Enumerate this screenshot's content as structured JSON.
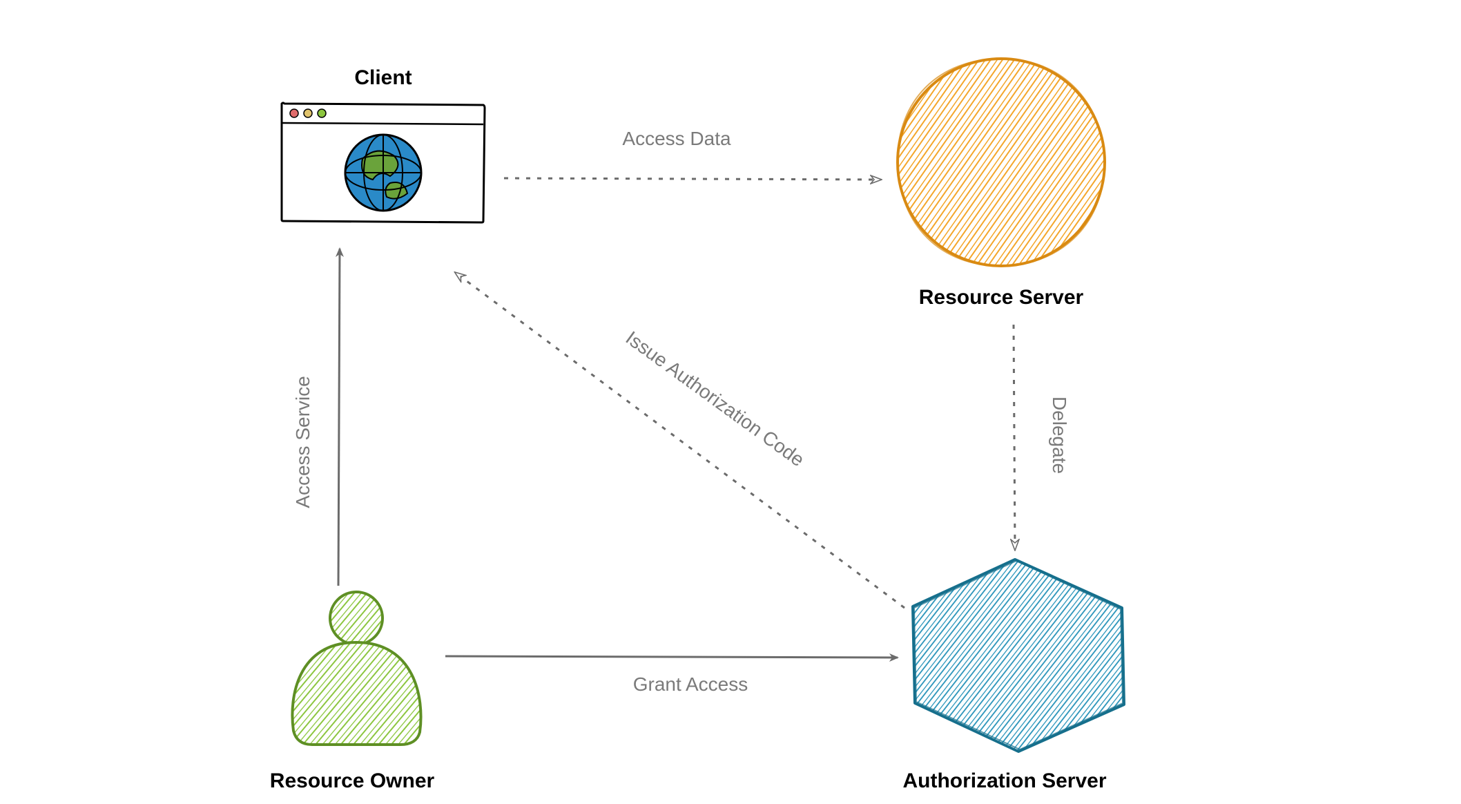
{
  "diagram": {
    "nodes": {
      "client": {
        "label": "Client"
      },
      "resource_server": {
        "label": "Resource Server"
      },
      "authorization_server": {
        "label": "Authorization Server"
      },
      "resource_owner": {
        "label": "Resource Owner"
      }
    },
    "edges": {
      "access_data": {
        "label": "Access Data",
        "from": "client",
        "to": "resource_server",
        "style": "dashed"
      },
      "delegate": {
        "label": "Delegate",
        "from": "resource_server",
        "to": "authorization_server",
        "style": "dashed"
      },
      "issue_auth_code": {
        "label": "Issue Authorization Code",
        "from": "authorization_server",
        "to": "client",
        "style": "dashed"
      },
      "grant_access": {
        "label": "Grant Access",
        "from": "resource_owner",
        "to": "authorization_server",
        "style": "solid"
      },
      "access_service": {
        "label": "Access Service",
        "from": "resource_owner",
        "to": "client",
        "style": "solid"
      }
    },
    "colors": {
      "client_globe_ocean": "#2a8ac8",
      "client_globe_land": "#6aa33b",
      "resource_server_fill": "#f4a62a",
      "authorization_server_fill": "#2592b9",
      "resource_owner_fill": "#8cc63f",
      "arrow": "#6b6b6b",
      "dot_red": "#e06c6c",
      "dot_yellow": "#e0c36c",
      "dot_green": "#8cc63f"
    }
  }
}
